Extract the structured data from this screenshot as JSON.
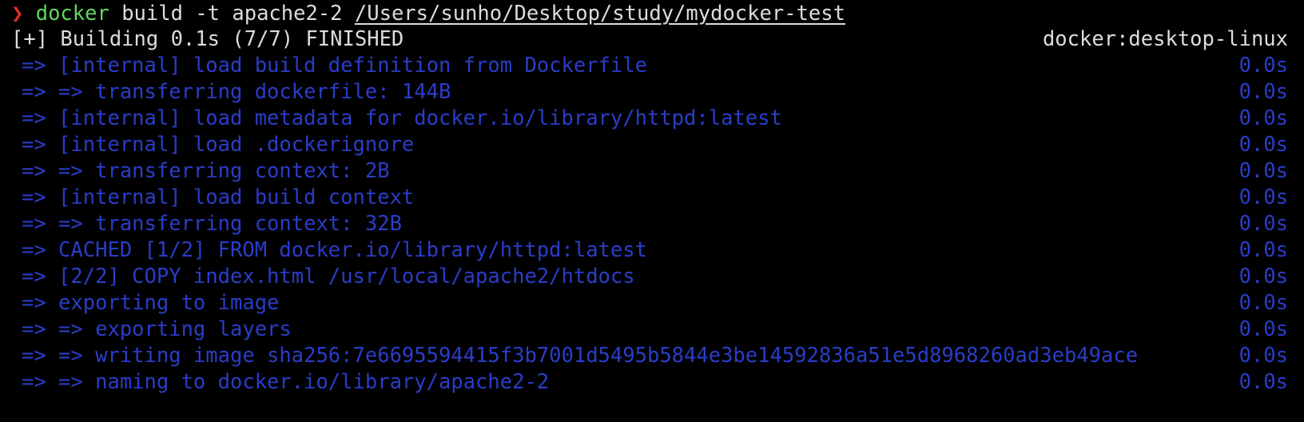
{
  "prompt": {
    "symbol": "❯",
    "command": "docker",
    "args": " build -t apache2-2 ",
    "path": "/Users/sunho/Desktop/study/mydocker-test"
  },
  "status": {
    "text": "[+] Building 0.1s (7/7) FINISHED",
    "context": "docker:desktop-linux"
  },
  "steps": [
    {
      "text": "=> [internal] load build definition from Dockerfile",
      "time": "0.0s"
    },
    {
      "text": "=> => transferring dockerfile: 144B",
      "time": "0.0s"
    },
    {
      "text": "=> [internal] load metadata for docker.io/library/httpd:latest",
      "time": "0.0s"
    },
    {
      "text": "=> [internal] load .dockerignore",
      "time": "0.0s"
    },
    {
      "text": "=> => transferring context: 2B",
      "time": "0.0s"
    },
    {
      "text": "=> [internal] load build context",
      "time": "0.0s"
    },
    {
      "text": "=> => transferring context: 32B",
      "time": "0.0s"
    },
    {
      "text": "=> CACHED [1/2] FROM docker.io/library/httpd:latest",
      "time": "0.0s"
    },
    {
      "text": "=> [2/2] COPY index.html /usr/local/apache2/htdocs",
      "time": "0.0s"
    },
    {
      "text": "=> exporting to image",
      "time": "0.0s"
    },
    {
      "text": "=> => exporting layers",
      "time": "0.0s"
    },
    {
      "text": "=> => writing image sha256:7e6695594415f3b7001d5495b5844e3be14592836a51e5d8968260ad3eb49ace",
      "time": "0.0s"
    },
    {
      "text": "=> => naming to docker.io/library/apache2-2",
      "time": "0.0s"
    }
  ],
  "colors": {
    "background": "#000000",
    "prompt_symbol": "#e0301e",
    "command": "#5fd75f",
    "default_text": "#dcdcdc",
    "step_text": "#2a3dc8"
  }
}
